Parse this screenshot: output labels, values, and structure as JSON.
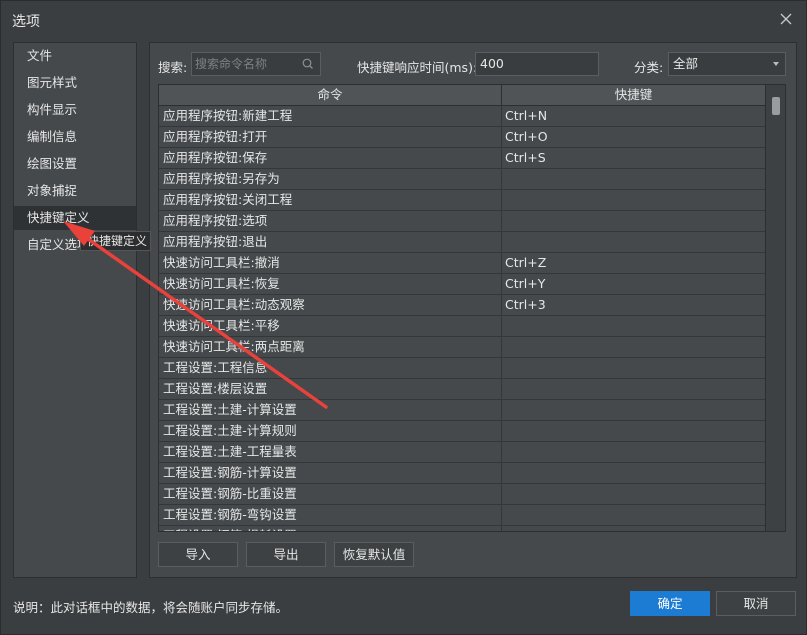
{
  "window": {
    "title": "选项"
  },
  "sidebar": {
    "items": [
      {
        "label": "文件"
      },
      {
        "label": "图元样式"
      },
      {
        "label": "构件显示"
      },
      {
        "label": "编制信息"
      },
      {
        "label": "绘图设置"
      },
      {
        "label": "对象捕捉"
      },
      {
        "label": "快捷键定义",
        "active": true
      },
      {
        "label": "自定义选项"
      }
    ]
  },
  "tooltip": {
    "text": "快捷键定义"
  },
  "toolbar": {
    "search_label": "搜索:",
    "search_placeholder": "搜索命令名称",
    "search_value": "",
    "response_label": "快捷键响应时间(ms):",
    "response_value": "400",
    "category_label": "分类:",
    "category_value": "全部"
  },
  "table": {
    "headers": {
      "command": "命令",
      "shortcut": "快捷键"
    },
    "rows": [
      {
        "command": "应用程序按钮:新建工程",
        "shortcut": "Ctrl+N"
      },
      {
        "command": "应用程序按钮:打开",
        "shortcut": "Ctrl+O"
      },
      {
        "command": "应用程序按钮:保存",
        "shortcut": "Ctrl+S"
      },
      {
        "command": "应用程序按钮:另存为",
        "shortcut": ""
      },
      {
        "command": "应用程序按钮:关闭工程",
        "shortcut": ""
      },
      {
        "command": "应用程序按钮:选项",
        "shortcut": ""
      },
      {
        "command": "应用程序按钮:退出",
        "shortcut": ""
      },
      {
        "command": "快速访问工具栏:撤消",
        "shortcut": "Ctrl+Z"
      },
      {
        "command": "快速访问工具栏:恢复",
        "shortcut": "Ctrl+Y"
      },
      {
        "command": "快速访问工具栏:动态观察",
        "shortcut": "Ctrl+3"
      },
      {
        "command": "快速访问工具栏:平移",
        "shortcut": ""
      },
      {
        "command": "快速访问工具栏:两点距离",
        "shortcut": ""
      },
      {
        "command": "工程设置:工程信息",
        "shortcut": ""
      },
      {
        "command": "工程设置:楼层设置",
        "shortcut": ""
      },
      {
        "command": "工程设置:土建-计算设置",
        "shortcut": ""
      },
      {
        "command": "工程设置:土建-计算规则",
        "shortcut": ""
      },
      {
        "command": "工程设置:土建-工程量表",
        "shortcut": ""
      },
      {
        "command": "工程设置:钢筋-计算设置",
        "shortcut": ""
      },
      {
        "command": "工程设置:钢筋-比重设置",
        "shortcut": ""
      },
      {
        "command": "工程设置:钢筋-弯钩设置",
        "shortcut": ""
      },
      {
        "command": "工程设置:钢筋-损耗设置",
        "shortcut": ""
      }
    ]
  },
  "actions": {
    "import_label": "导入",
    "export_label": "导出",
    "reset_label": "恢复默认值"
  },
  "footer": {
    "note": "说明：此对话框中的数据，将会随账户同步存储。",
    "ok_label": "确定",
    "cancel_label": "取消"
  },
  "colors": {
    "background": "#3b3e40",
    "panel": "#45494c",
    "primary": "#1c7bd3",
    "annotation_arrow": "#e8423b"
  }
}
